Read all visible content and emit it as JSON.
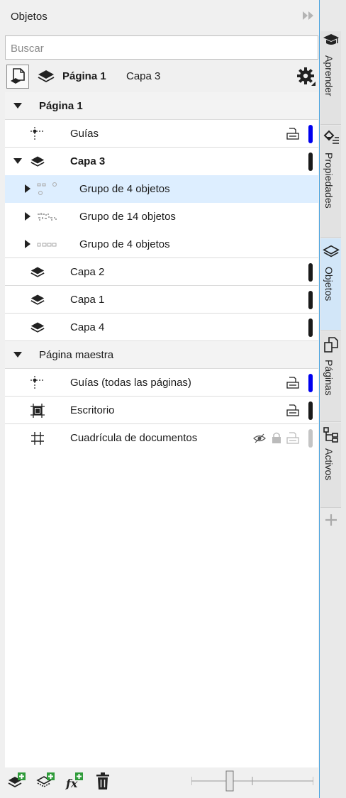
{
  "docker": {
    "title": "Objetos"
  },
  "search": {
    "placeholder": "Buscar"
  },
  "toolbar": {
    "current_page": "Página 1",
    "current_layer": "Capa 3"
  },
  "tree": {
    "page1": {
      "label": "Página 1"
    },
    "guides": {
      "label": "Guías"
    },
    "layer3": {
      "label": "Capa 3"
    },
    "group_a": {
      "label": "Grupo de 4 objetos"
    },
    "group_b": {
      "label": "Grupo de 14 objetos"
    },
    "group_c": {
      "label": "Grupo de 4 objetos"
    },
    "layer2": {
      "label": "Capa 2"
    },
    "layer1": {
      "label": "Capa 1"
    },
    "layer4": {
      "label": "Capa 4"
    },
    "master": {
      "label": "Página maestra"
    },
    "master_guides": {
      "label": "Guías (todas las páginas)"
    },
    "desktop": {
      "label": "Escritorio"
    },
    "grid": {
      "label": "Cuadrícula de documentos"
    }
  },
  "side_tabs": {
    "learn": "Aprender",
    "properties": "Propiedades",
    "objects": "Objetos",
    "pages": "Páginas",
    "assets": "Activos"
  },
  "colors": {
    "guides_layer": "#0000ee",
    "layer_default": "#1a1a1a",
    "grid_layer": "#c4c4c4",
    "selection": "#ddeeff",
    "accent": "#4aa3df"
  }
}
